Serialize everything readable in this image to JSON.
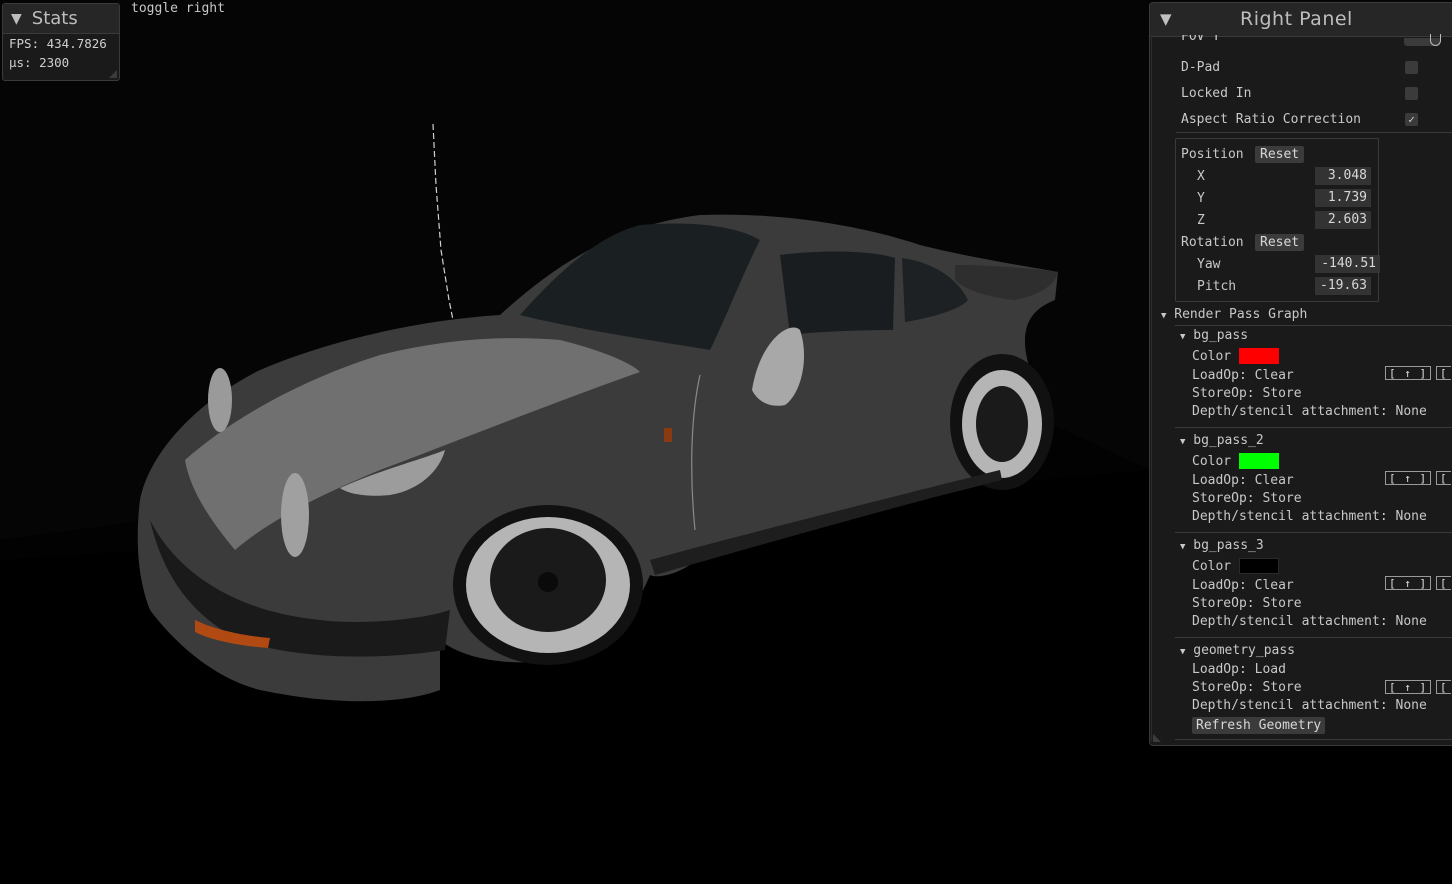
{
  "overlay": {
    "toggle_label": "toggle right"
  },
  "stats": {
    "title": "Stats",
    "fps_line": "FPS: 434.7826",
    "us_line": "μs: 2300"
  },
  "right_panel": {
    "title": "Right Panel",
    "fov_label": "FOV Y",
    "toggles": [
      {
        "label": "D-Pad",
        "checked": false
      },
      {
        "label": "Locked In",
        "checked": false
      },
      {
        "label": "Aspect Ratio Correction",
        "checked": true
      }
    ],
    "check_glyph": "✓",
    "reset_label": "Reset",
    "position": {
      "label": "Position",
      "x_label": "X",
      "x": "3.048",
      "y_label": "Y",
      "y": "1.739",
      "z_label": "Z",
      "z": "2.603"
    },
    "rotation": {
      "label": "Rotation",
      "yaw_label": "Yaw",
      "yaw": "-140.51",
      "pitch_label": "Pitch",
      "pitch": "-19.63"
    },
    "render_pass_graph": {
      "label": "Render Pass Graph",
      "arrow_button": "[ ↑ ]",
      "clipped_button": "[",
      "passes": [
        {
          "name": "bg_pass",
          "color_label": "Color",
          "color": "#ff0000",
          "load_op": "LoadOp: Clear",
          "store_op": "StoreOp: Store",
          "depth": "Depth/stencil attachment: None"
        },
        {
          "name": "bg_pass_2",
          "color_label": "Color",
          "color": "#00ff00",
          "load_op": "LoadOp: Clear",
          "store_op": "StoreOp: Store",
          "depth": "Depth/stencil attachment: None"
        },
        {
          "name": "bg_pass_3",
          "color_label": "Color",
          "color": "#000000",
          "load_op": "LoadOp: Clear",
          "store_op": "StoreOp: Store",
          "depth": "Depth/stencil attachment: None"
        },
        {
          "name": "geometry_pass",
          "load_op": "LoadOp: Load",
          "store_op": "StoreOp: Store",
          "depth": "Depth/stencil attachment: None",
          "refresh_label": "Refresh Geometry"
        }
      ]
    }
  },
  "colors": {
    "background": "#050505",
    "panel_bg": "#1a1a1a",
    "titlebar_bg": "#262626",
    "car_body": "#3c3c3c"
  }
}
